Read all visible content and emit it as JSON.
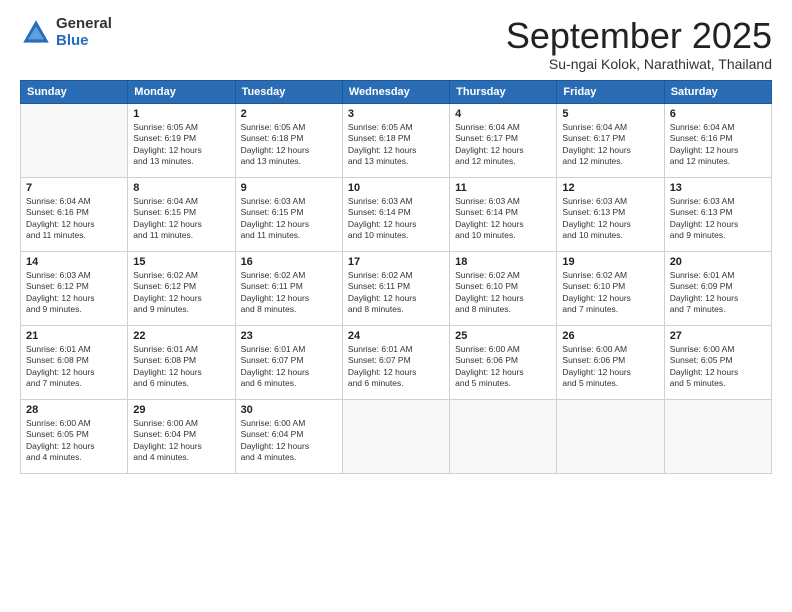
{
  "logo": {
    "general": "General",
    "blue": "Blue",
    "icon": "▶"
  },
  "title": "September 2025",
  "location": "Su-ngai Kolok, Narathiwat, Thailand",
  "weekdays": [
    "Sunday",
    "Monday",
    "Tuesday",
    "Wednesday",
    "Thursday",
    "Friday",
    "Saturday"
  ],
  "weeks": [
    [
      {
        "day": "",
        "info": ""
      },
      {
        "day": "1",
        "info": "Sunrise: 6:05 AM\nSunset: 6:19 PM\nDaylight: 12 hours\nand 13 minutes."
      },
      {
        "day": "2",
        "info": "Sunrise: 6:05 AM\nSunset: 6:18 PM\nDaylight: 12 hours\nand 13 minutes."
      },
      {
        "day": "3",
        "info": "Sunrise: 6:05 AM\nSunset: 6:18 PM\nDaylight: 12 hours\nand 13 minutes."
      },
      {
        "day": "4",
        "info": "Sunrise: 6:04 AM\nSunset: 6:17 PM\nDaylight: 12 hours\nand 12 minutes."
      },
      {
        "day": "5",
        "info": "Sunrise: 6:04 AM\nSunset: 6:17 PM\nDaylight: 12 hours\nand 12 minutes."
      },
      {
        "day": "6",
        "info": "Sunrise: 6:04 AM\nSunset: 6:16 PM\nDaylight: 12 hours\nand 12 minutes."
      }
    ],
    [
      {
        "day": "7",
        "info": "Sunrise: 6:04 AM\nSunset: 6:16 PM\nDaylight: 12 hours\nand 11 minutes."
      },
      {
        "day": "8",
        "info": "Sunrise: 6:04 AM\nSunset: 6:15 PM\nDaylight: 12 hours\nand 11 minutes."
      },
      {
        "day": "9",
        "info": "Sunrise: 6:03 AM\nSunset: 6:15 PM\nDaylight: 12 hours\nand 11 minutes."
      },
      {
        "day": "10",
        "info": "Sunrise: 6:03 AM\nSunset: 6:14 PM\nDaylight: 12 hours\nand 10 minutes."
      },
      {
        "day": "11",
        "info": "Sunrise: 6:03 AM\nSunset: 6:14 PM\nDaylight: 12 hours\nand 10 minutes."
      },
      {
        "day": "12",
        "info": "Sunrise: 6:03 AM\nSunset: 6:13 PM\nDaylight: 12 hours\nand 10 minutes."
      },
      {
        "day": "13",
        "info": "Sunrise: 6:03 AM\nSunset: 6:13 PM\nDaylight: 12 hours\nand 9 minutes."
      }
    ],
    [
      {
        "day": "14",
        "info": "Sunrise: 6:03 AM\nSunset: 6:12 PM\nDaylight: 12 hours\nand 9 minutes."
      },
      {
        "day": "15",
        "info": "Sunrise: 6:02 AM\nSunset: 6:12 PM\nDaylight: 12 hours\nand 9 minutes."
      },
      {
        "day": "16",
        "info": "Sunrise: 6:02 AM\nSunset: 6:11 PM\nDaylight: 12 hours\nand 8 minutes."
      },
      {
        "day": "17",
        "info": "Sunrise: 6:02 AM\nSunset: 6:11 PM\nDaylight: 12 hours\nand 8 minutes."
      },
      {
        "day": "18",
        "info": "Sunrise: 6:02 AM\nSunset: 6:10 PM\nDaylight: 12 hours\nand 8 minutes."
      },
      {
        "day": "19",
        "info": "Sunrise: 6:02 AM\nSunset: 6:10 PM\nDaylight: 12 hours\nand 7 minutes."
      },
      {
        "day": "20",
        "info": "Sunrise: 6:01 AM\nSunset: 6:09 PM\nDaylight: 12 hours\nand 7 minutes."
      }
    ],
    [
      {
        "day": "21",
        "info": "Sunrise: 6:01 AM\nSunset: 6:08 PM\nDaylight: 12 hours\nand 7 minutes."
      },
      {
        "day": "22",
        "info": "Sunrise: 6:01 AM\nSunset: 6:08 PM\nDaylight: 12 hours\nand 6 minutes."
      },
      {
        "day": "23",
        "info": "Sunrise: 6:01 AM\nSunset: 6:07 PM\nDaylight: 12 hours\nand 6 minutes."
      },
      {
        "day": "24",
        "info": "Sunrise: 6:01 AM\nSunset: 6:07 PM\nDaylight: 12 hours\nand 6 minutes."
      },
      {
        "day": "25",
        "info": "Sunrise: 6:00 AM\nSunset: 6:06 PM\nDaylight: 12 hours\nand 5 minutes."
      },
      {
        "day": "26",
        "info": "Sunrise: 6:00 AM\nSunset: 6:06 PM\nDaylight: 12 hours\nand 5 minutes."
      },
      {
        "day": "27",
        "info": "Sunrise: 6:00 AM\nSunset: 6:05 PM\nDaylight: 12 hours\nand 5 minutes."
      }
    ],
    [
      {
        "day": "28",
        "info": "Sunrise: 6:00 AM\nSunset: 6:05 PM\nDaylight: 12 hours\nand 4 minutes."
      },
      {
        "day": "29",
        "info": "Sunrise: 6:00 AM\nSunset: 6:04 PM\nDaylight: 12 hours\nand 4 minutes."
      },
      {
        "day": "30",
        "info": "Sunrise: 6:00 AM\nSunset: 6:04 PM\nDaylight: 12 hours\nand 4 minutes."
      },
      {
        "day": "",
        "info": ""
      },
      {
        "day": "",
        "info": ""
      },
      {
        "day": "",
        "info": ""
      },
      {
        "day": "",
        "info": ""
      }
    ]
  ]
}
